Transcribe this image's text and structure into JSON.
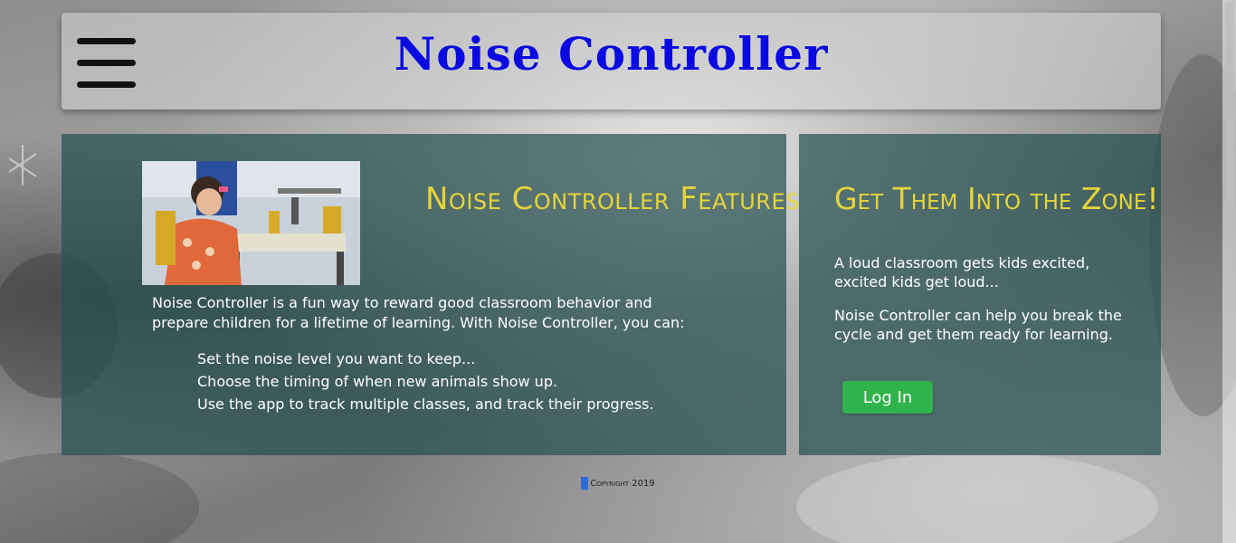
{
  "header": {
    "title": "Noise Controller",
    "menu_icon": "hamburger-menu-icon",
    "title_color": "#0a0ae0"
  },
  "features": {
    "title": "Noise Controller Features",
    "intro": "Noise Controller is a fun way to reward good classroom behavior and prepare children for a lifetime of learning. With Noise Controller, you can:",
    "items": [
      "Set the noise level you want to keep...",
      "Choose the timing of when new animals show up.",
      "Use the app to track multiple classes, and track their progress."
    ],
    "image_alt": "classroom-photo"
  },
  "zone": {
    "title": "Get Them Into the Zone!",
    "paragraph1": "A loud classroom gets kids excited, excited kids get loud...",
    "paragraph2": "Noise Controller can help you break the cycle and get them ready for learning.",
    "login_label": "Log In"
  },
  "footer": {
    "copyright": "Copyright 2019"
  },
  "colors": {
    "heading": "#e6d53a",
    "panel": "#285050",
    "button": "#2fb34a"
  }
}
